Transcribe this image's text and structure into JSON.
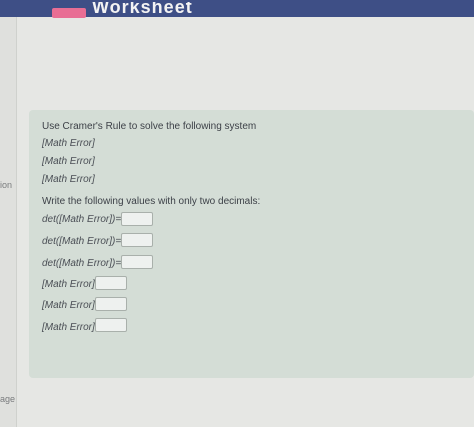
{
  "header": {
    "title": "Worksheet"
  },
  "left_sidebar": {
    "label_top": "ion",
    "label_bottom": "age"
  },
  "problem": {
    "instruction": "Use Cramer's Rule to solve the following system",
    "equations": [
      "[Math Error]",
      "[Math Error]",
      "[Math Error]"
    ],
    "decimals_note": "Write the following values with only two decimals:",
    "determinants": [
      {
        "label": "det([Math Error])=",
        "value": ""
      },
      {
        "label": "det([Math Error])=",
        "value": ""
      },
      {
        "label": "det([Math Error])=",
        "value": ""
      }
    ],
    "solutions": [
      {
        "label": "[Math Error]",
        "value": ""
      },
      {
        "label": "[Math Error]",
        "value": ""
      },
      {
        "label": "[Math Error]",
        "value": ""
      }
    ]
  }
}
